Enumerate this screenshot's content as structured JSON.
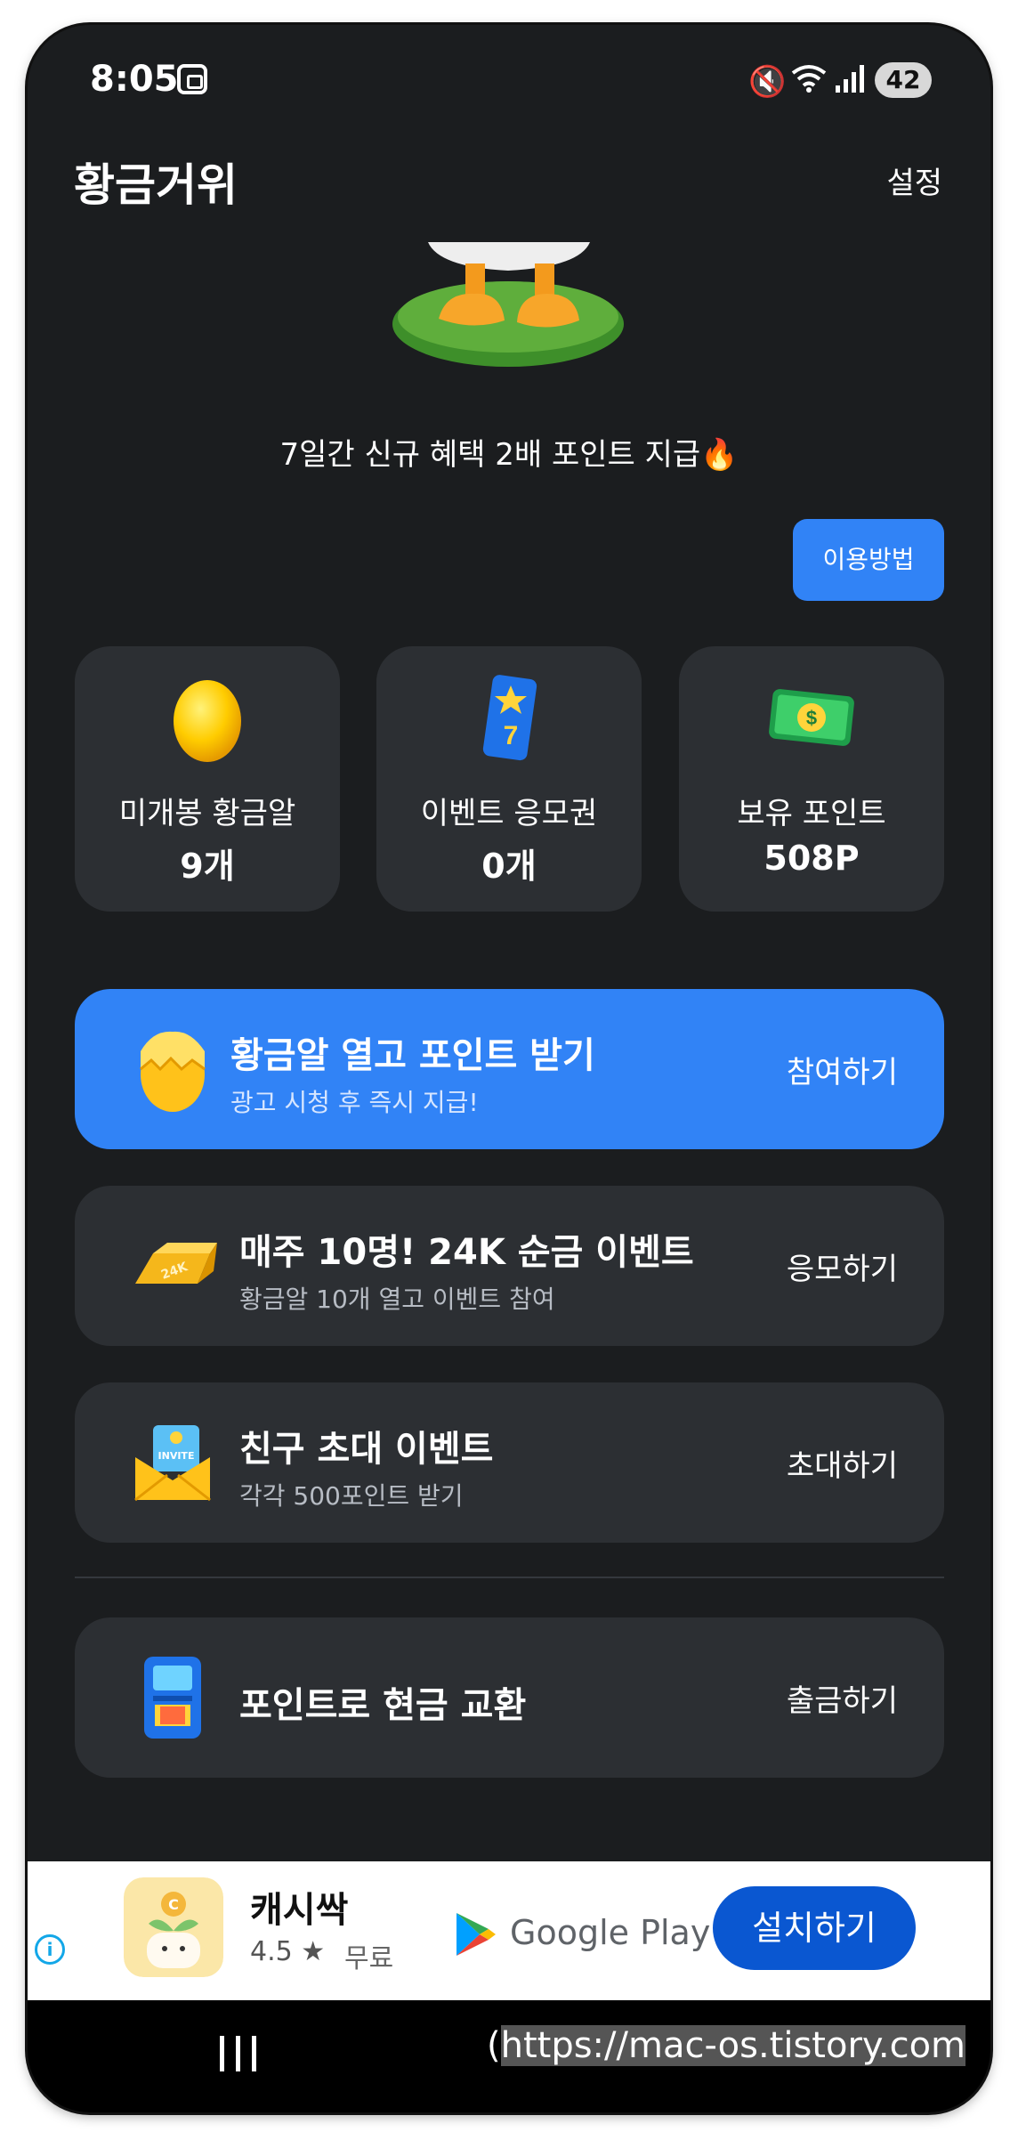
{
  "status_bar": {
    "time": "8:05",
    "battery": "42"
  },
  "header": {
    "title": "황금거위",
    "settings_label": "설정"
  },
  "promo_text": "7일간 신규 혜택 2배 포인트 지급🔥",
  "howto_label": "이용방법",
  "stats": [
    {
      "label": "미개봉 황금알",
      "value": "9개",
      "icon": "golden-egg-icon"
    },
    {
      "label": "이벤트 응모권",
      "value": "0개",
      "icon": "ticket-icon"
    },
    {
      "label": "보유 포인트",
      "value": "508P",
      "icon": "money-icon"
    }
  ],
  "cards": {
    "open_egg": {
      "title": "황금알 열고 포인트 받기",
      "subtitle": "광고 시청 후 즉시 지급!",
      "action": "참여하기",
      "icon": "cracked-egg-icon"
    },
    "gold_event": {
      "title": "매주 10명! 24K 순금 이벤트",
      "subtitle": "황금알 10개 열고 이벤트 참여",
      "action": "응모하기",
      "icon": "gold-bar-icon",
      "icon_text": "24K"
    },
    "invite": {
      "title": "친구 초대 이벤트",
      "subtitle": "각각 500포인트 받기",
      "action": "초대하기",
      "icon": "invite-envelope-icon",
      "icon_text": "INVITE"
    },
    "cash_out": {
      "title": "포인트로 현금 교환",
      "action": "출금하기",
      "icon": "atm-icon"
    }
  },
  "ad": {
    "app_name": "캐시싹",
    "rating": "4.5 ★",
    "price": "무료",
    "store": "Google Play",
    "install_label": "설치하기"
  },
  "watermark": {
    "paren": "(",
    "url": "https://mac-os.tistory.com"
  },
  "colors": {
    "background": "#1b1d1f",
    "card": "#2c2f33",
    "accent": "#3183f6",
    "install": "#0a57d1"
  }
}
